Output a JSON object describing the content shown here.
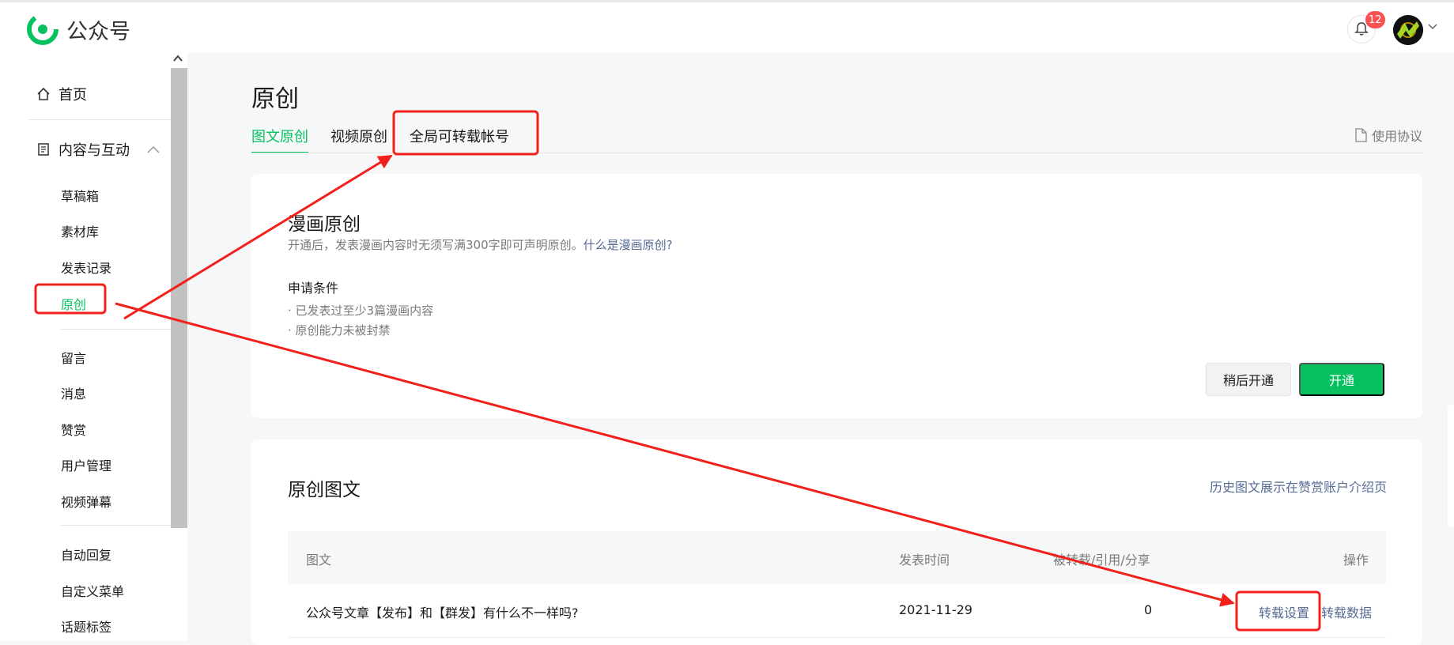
{
  "brand": {
    "name": "公众号"
  },
  "topbar": {
    "notification_count": "12"
  },
  "sidebar": {
    "home": "首页",
    "section": "内容与互动",
    "group1": [
      "草稿箱",
      "素材库",
      "发表记录",
      "原创"
    ],
    "group2": [
      "留言",
      "消息",
      "赞赏",
      "用户管理",
      "视频弹幕"
    ],
    "group3": [
      "自动回复",
      "自定义菜单",
      "话题标签"
    ]
  },
  "page": {
    "title": "原创",
    "tabs": [
      "图文原创",
      "视频原创",
      "全局可转载帐号"
    ],
    "agreement": "使用协议"
  },
  "comic": {
    "title": "漫画原创",
    "desc": "开通后，发表漫画内容时无须写满300字即可声明原创。",
    "desc_link": "什么是漫画原创?",
    "conditions_title": "申请条件",
    "conditions": [
      "· 已发表过至少3篇漫画内容",
      "· 原创能力未被封禁"
    ],
    "btn_later": "稍后开通",
    "btn_open": "开通"
  },
  "original": {
    "title": "原创图文",
    "history_link": "历史图文展示在赞赏账户介绍页",
    "columns": [
      "图文",
      "发表时间",
      "被转载/引用/分享",
      "操作"
    ],
    "rows": [
      {
        "title": "公众号文章【发布】和【群发】有什么不一样吗?",
        "date": "2021-11-29",
        "count": "0",
        "action1": "转载设置",
        "action2": "转载数据"
      }
    ]
  },
  "colors": {
    "brand_green": "#07c160",
    "link_blue": "#576b95",
    "annotation_red": "#f2201b"
  }
}
